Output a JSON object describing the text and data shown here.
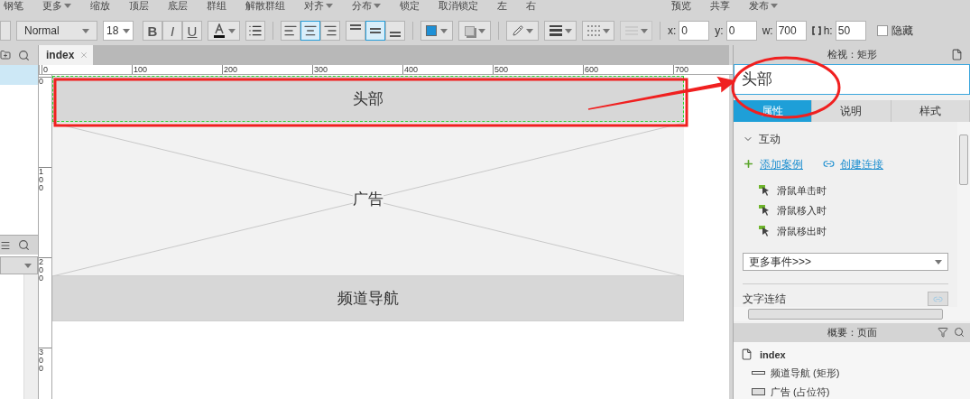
{
  "menu": [
    {
      "label": "钢笔",
      "dropdown": false
    },
    {
      "label": "更多",
      "dropdown": true
    },
    {
      "label": "缩放",
      "dropdown": false
    },
    {
      "label": "顶层",
      "dropdown": false
    },
    {
      "label": "底层",
      "dropdown": false
    },
    {
      "label": "群组",
      "dropdown": false
    },
    {
      "label": "解散群组",
      "dropdown": false
    },
    {
      "label": "对齐",
      "dropdown": true
    },
    {
      "label": "分布",
      "dropdown": true
    },
    {
      "label": "锁定",
      "dropdown": false
    },
    {
      "label": "取消锁定",
      "dropdown": false
    },
    {
      "label": "左",
      "dropdown": false
    },
    {
      "label": "右",
      "dropdown": false
    },
    {
      "label": "预览",
      "dropdown": false
    },
    {
      "label": "共享",
      "dropdown": false
    },
    {
      "label": "发布",
      "dropdown": true
    }
  ],
  "toolbar": {
    "font_family": "Normal",
    "font_size": "18",
    "text_styles": [
      {
        "kind": "bold",
        "label": "B"
      },
      {
        "kind": "italic",
        "label": "I"
      },
      {
        "kind": "underline",
        "label": "U"
      }
    ],
    "align": [
      {
        "kind": "left",
        "selected": false
      },
      {
        "kind": "center",
        "selected": true
      },
      {
        "kind": "right",
        "selected": false
      }
    ],
    "valign": [
      {
        "kind": "top",
        "selected": false
      },
      {
        "kind": "middle",
        "selected": true
      },
      {
        "kind": "bottom",
        "selected": false
      }
    ],
    "fields": [
      {
        "label": "x:",
        "value": "0"
      },
      {
        "label": "y:",
        "value": "0"
      },
      {
        "label": "w:",
        "value": "700"
      },
      {
        "label": "h:",
        "value": "50"
      }
    ],
    "hidden": {
      "label": "隐藏",
      "checked": false
    }
  },
  "canvas": {
    "tab": "index",
    "h_ruler": [
      "0",
      "100",
      "200",
      "300",
      "400",
      "500",
      "600",
      "700"
    ],
    "v_ruler": [
      "0",
      "100",
      "200",
      "300"
    ],
    "widgets": [
      {
        "kind": "rect",
        "label": "头部",
        "selected": true
      },
      {
        "kind": "placeholder",
        "label": "广告",
        "selected": false
      },
      {
        "kind": "rect",
        "label": "频道导航",
        "selected": false
      }
    ]
  },
  "inspector": {
    "title": "检视：矩形",
    "name": "头部",
    "tabs": [
      {
        "label": "属性",
        "selected": true
      },
      {
        "label": "说明",
        "selected": false
      },
      {
        "label": "样式",
        "selected": false
      }
    ],
    "section": "互动",
    "actions": [
      {
        "kind": "add",
        "label": "添加案例"
      },
      {
        "kind": "link",
        "label": "创建连接"
      }
    ],
    "events": [
      "滑鼠单击时",
      "滑鼠移入时",
      "滑鼠移出时"
    ],
    "more_events": "更多事件>>>",
    "text_link": "文字连结"
  },
  "outline": {
    "title": "概要：页面",
    "page": "index",
    "items": [
      {
        "kind": "rect",
        "label": "频道导航 (矩形)"
      },
      {
        "kind": "placeholder",
        "label": "广告 (占位符)"
      }
    ]
  }
}
